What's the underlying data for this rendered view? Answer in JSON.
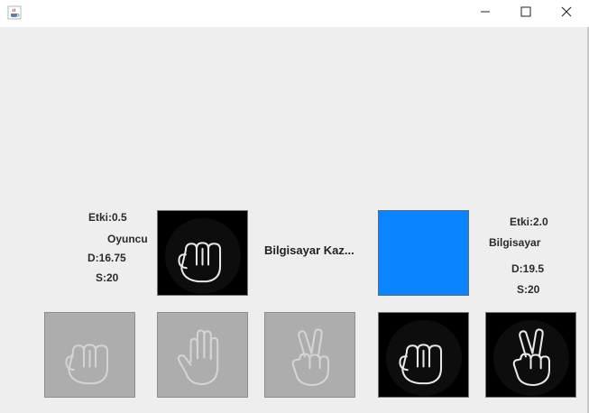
{
  "window": {
    "minimize_icon": "minimize-icon",
    "maximize_icon": "maximize-icon",
    "close_icon": "close-icon",
    "app_icon": "java-coffee-cup-icon"
  },
  "player": {
    "effect": "Etki:0.5",
    "name": "Oyuncu",
    "defense": "D:16.75",
    "strength": "S:20"
  },
  "computer": {
    "effect": "Etki:2.0",
    "name": "Bilgisayar",
    "defense": "D:19.5",
    "strength": "S:20"
  },
  "status_text": "Bilgisayar Kaz...",
  "selected": {
    "player_card": "fist-icon",
    "computer_card_color": "#0a84ff"
  },
  "player_hand": [
    {
      "icon": "fist-icon",
      "state": "disabled"
    },
    {
      "icon": "open-hand-icon",
      "state": "disabled"
    },
    {
      "icon": "victory-hand-icon",
      "state": "disabled"
    }
  ],
  "computer_hand": [
    {
      "icon": "fist-icon",
      "state": "active"
    },
    {
      "icon": "victory-hand-icon",
      "state": "active"
    }
  ],
  "colors": {
    "content_bg": "#eeeeee",
    "card_dark": "#000000",
    "card_disabled": "#adadad",
    "card_selected": "#0a84ff"
  }
}
